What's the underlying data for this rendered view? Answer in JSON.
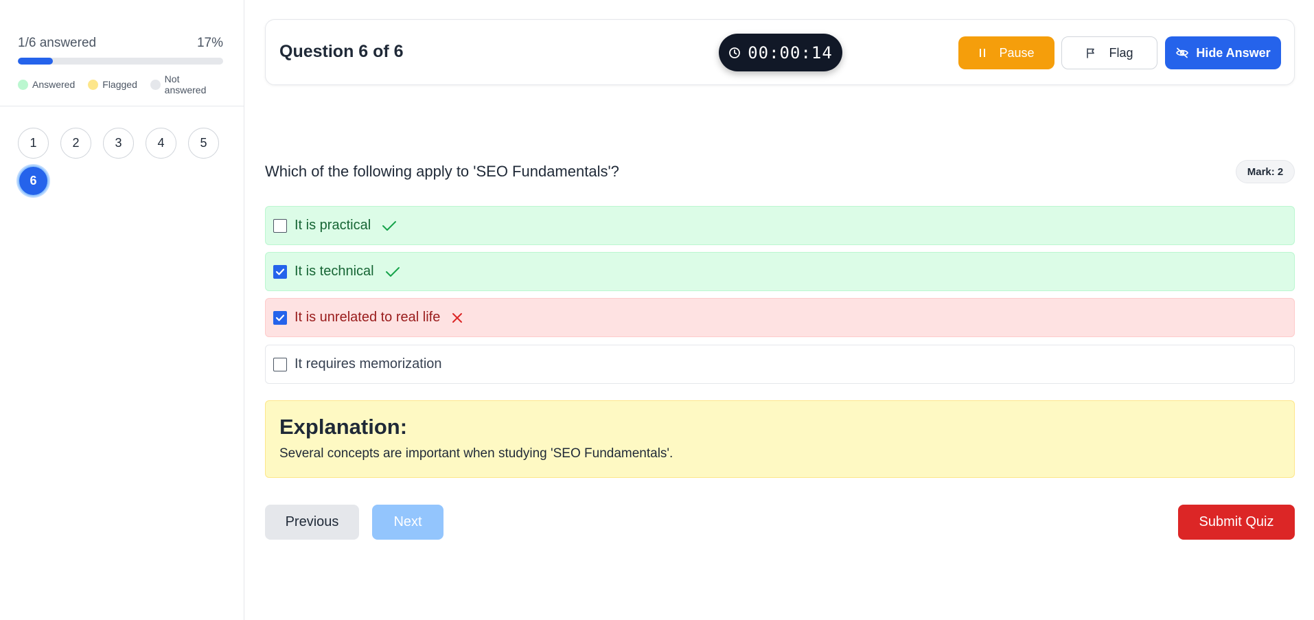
{
  "sidebar": {
    "progress_label": "1/6 answered",
    "progress_percent_label": "17%",
    "progress_fraction": 0.17,
    "legend": [
      {
        "label": "Answered",
        "color": "#bbf7d0"
      },
      {
        "label": "Flagged",
        "color": "#fde68a"
      },
      {
        "label": "Not answered",
        "color": "#e5e7eb"
      }
    ],
    "questions": [
      "1",
      "2",
      "3",
      "4",
      "5",
      "6"
    ],
    "active_question": "6"
  },
  "header": {
    "title": "Question 6 of 6",
    "timer": "00:00:14",
    "pause_label": "Pause",
    "flag_label": "Flag",
    "hide_answer_label": "Hide Answer"
  },
  "question": {
    "text": "Which of the following apply to 'SEO Fundamentals'?",
    "mark_label": "Mark: 2",
    "options": [
      {
        "label": "It is practical",
        "checked": false,
        "status": "correct"
      },
      {
        "label": "It is technical",
        "checked": true,
        "status": "correct"
      },
      {
        "label": "It is unrelated to real life",
        "checked": true,
        "status": "wrong"
      },
      {
        "label": "It requires memorization",
        "checked": false,
        "status": "neutral"
      }
    ]
  },
  "explanation": {
    "title": "Explanation:",
    "body": "Several concepts are important when studying 'SEO Fundamentals'."
  },
  "footer": {
    "previous_label": "Previous",
    "next_label": "Next",
    "submit_label": "Submit Quiz"
  },
  "colors": {
    "accent": "#2563eb",
    "pause": "#f59e0b",
    "submit": "#dc2626",
    "correct_bg": "#dcfce7",
    "wrong_bg": "#fee2e2",
    "explanation_bg": "#fef9c3"
  },
  "icons": {
    "timer": "clock-icon",
    "pause": "pause-icon",
    "flag": "flag-icon",
    "hide_answer": "eye-off-icon",
    "correct": "check-icon",
    "wrong": "cross-icon"
  }
}
